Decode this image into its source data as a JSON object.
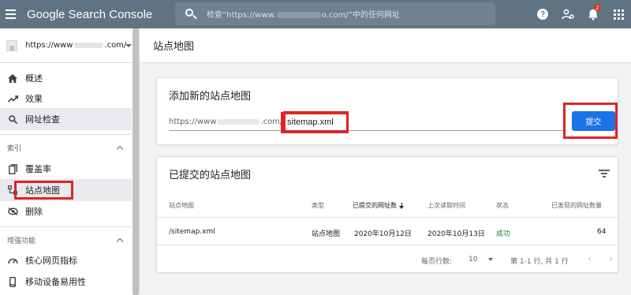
{
  "header": {
    "brand": "Google Search Console",
    "search_prefix": "检查“https://www.",
    "search_suffix": "o.com/”中的任何网址",
    "notification_count": "2",
    "icons": [
      "menu-icon",
      "search-icon",
      "help-icon",
      "account-settings-icon",
      "notifications-icon",
      "apps-icon"
    ]
  },
  "sidebar": {
    "property_prefix": "https://www",
    "property_suffix": ".com/",
    "nav_top": [
      {
        "label": "概述",
        "icon": "home-icon"
      },
      {
        "label": "效果",
        "icon": "trending-up-icon"
      },
      {
        "label": "网址检查",
        "icon": "search-icon",
        "selected": true
      }
    ],
    "section_index": "索引",
    "nav_index": [
      {
        "label": "覆盖率",
        "icon": "coverage-icon"
      },
      {
        "label": "站点地图",
        "icon": "sitemap-icon",
        "selected": true
      },
      {
        "label": "删除",
        "icon": "removals-icon"
      }
    ],
    "section_enhancements": "增强功能",
    "nav_enhancements": [
      {
        "label": "核心网页指标",
        "icon": "speed-icon"
      },
      {
        "label": "移动设备易用性",
        "icon": "smartphone-icon"
      }
    ]
  },
  "page": {
    "title": "站点地图"
  },
  "add_card": {
    "title": "添加新的站点地图",
    "url_prefix": "https://www",
    "url_suffix": ".com/",
    "input_value": "sitemap.xml",
    "submit_label": "提交"
  },
  "submitted_card": {
    "title": "已提交的站点地图",
    "columns": [
      "站点地图",
      "类型",
      "已提交的网址数",
      "上次读取时间",
      "状态",
      "已发现的网址数量"
    ],
    "rows": [
      {
        "sitemap": "/sitemap.xml",
        "type": "站点地图",
        "submitted": "2020年10月12日",
        "last_read": "2020年10月13日",
        "status": "成功",
        "discovered": "64"
      }
    ],
    "pager": {
      "rows_per_page_label": "每页行数:",
      "rows_per_page_value": "10",
      "range_text": "第 1-1 行, 共 1 行"
    }
  },
  "colors": {
    "topbar": "#5f7382",
    "primary": "#1a73e8",
    "success": "#188038",
    "highlight": "#e02424"
  }
}
